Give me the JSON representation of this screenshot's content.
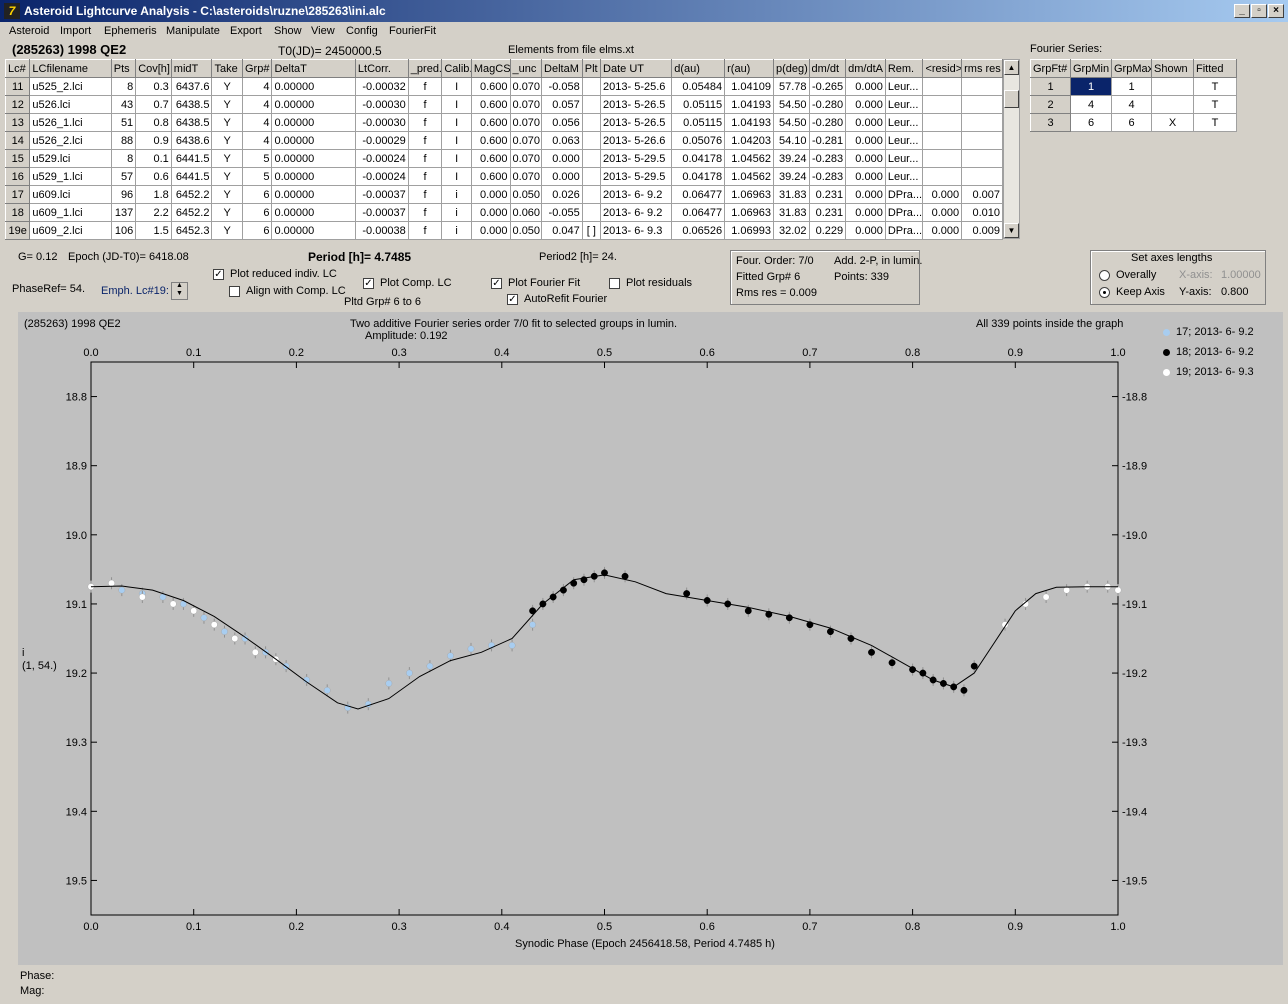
{
  "window": {
    "title": "Asteroid Lightcurve Analysis - C:\\asteroids\\ruzne\\285263\\ini.alc"
  },
  "menu": [
    "Asteroid",
    "Import",
    "Ephemeris",
    "Manipulate",
    "Export",
    "Show",
    "View",
    "Config",
    "FourierFit"
  ],
  "header": {
    "asteroid": "(285263) 1998 QE2",
    "t0": "T0(JD)= 2450000.5",
    "elements": "Elements from file elms.xt"
  },
  "table": {
    "columns": [
      "Lc#",
      "LCfilename",
      "Pts",
      "Cov[h]",
      "midT",
      "Take",
      "Grp#",
      "DeltaT",
      "LtCorr.",
      "_pred.",
      "Calib.",
      "MagCS",
      "_unc",
      "DeltaM",
      "Plt",
      "Date UT",
      "d(au)",
      "r(au)",
      "p(deg)",
      "dm/dt",
      "dm/dtA",
      "Rem.",
      "<resid>",
      "rms res"
    ],
    "rows": [
      [
        "11",
        "u525_2.lci",
        "8",
        "0.3",
        "6437.6",
        "Y",
        "4",
        "0.00000",
        "-0.00032",
        "f",
        "I",
        "0.600",
        "0.070",
        "-0.058",
        "",
        "2013- 5-25.6",
        "0.05484",
        "1.04109",
        "57.78",
        "-0.265",
        "0.000",
        "Leur...",
        "",
        ""
      ],
      [
        "12",
        "u526.lci",
        "43",
        "0.7",
        "6438.5",
        "Y",
        "4",
        "0.00000",
        "-0.00030",
        "f",
        "I",
        "0.600",
        "0.070",
        "0.057",
        "",
        "2013- 5-26.5",
        "0.05115",
        "1.04193",
        "54.50",
        "-0.280",
        "0.000",
        "Leur...",
        "",
        ""
      ],
      [
        "13",
        "u526_1.lci",
        "51",
        "0.8",
        "6438.5",
        "Y",
        "4",
        "0.00000",
        "-0.00030",
        "f",
        "I",
        "0.600",
        "0.070",
        "0.056",
        "",
        "2013- 5-26.5",
        "0.05115",
        "1.04193",
        "54.50",
        "-0.280",
        "0.000",
        "Leur...",
        "",
        ""
      ],
      [
        "14",
        "u526_2.lci",
        "88",
        "0.9",
        "6438.6",
        "Y",
        "4",
        "0.00000",
        "-0.00029",
        "f",
        "I",
        "0.600",
        "0.070",
        "0.063",
        "",
        "2013- 5-26.6",
        "0.05076",
        "1.04203",
        "54.10",
        "-0.281",
        "0.000",
        "Leur...",
        "",
        ""
      ],
      [
        "15",
        "u529.lci",
        "8",
        "0.1",
        "6441.5",
        "Y",
        "5",
        "0.00000",
        "-0.00024",
        "f",
        "I",
        "0.600",
        "0.070",
        "0.000",
        "",
        "2013- 5-29.5",
        "0.04178",
        "1.04562",
        "39.24",
        "-0.283",
        "0.000",
        "Leur...",
        "",
        ""
      ],
      [
        "16",
        "u529_1.lci",
        "57",
        "0.6",
        "6441.5",
        "Y",
        "5",
        "0.00000",
        "-0.00024",
        "f",
        "I",
        "0.600",
        "0.070",
        "0.000",
        "",
        "2013- 5-29.5",
        "0.04178",
        "1.04562",
        "39.24",
        "-0.283",
        "0.000",
        "Leur...",
        "",
        ""
      ],
      [
        "17",
        "u609.lci",
        "96",
        "1.8",
        "6452.2",
        "Y",
        "6",
        "0.00000",
        "-0.00037",
        "f",
        "i",
        "0.000",
        "0.050",
        "0.026",
        "",
        "2013- 6- 9.2",
        "0.06477",
        "1.06963",
        "31.83",
        "0.231",
        "0.000",
        "DPra...",
        "0.000",
        "0.007"
      ],
      [
        "18",
        "u609_1.lci",
        "137",
        "2.2",
        "6452.2",
        "Y",
        "6",
        "0.00000",
        "-0.00037",
        "f",
        "i",
        "0.000",
        "0.060",
        "-0.055",
        "",
        "2013- 6- 9.2",
        "0.06477",
        "1.06963",
        "31.83",
        "0.231",
        "0.000",
        "DPra...",
        "0.000",
        "0.010"
      ],
      [
        "19e",
        "u609_2.lci",
        "106",
        "1.5",
        "6452.3",
        "Y",
        "6",
        "0.00000",
        "-0.00038",
        "f",
        "i",
        "0.000",
        "0.050",
        "0.047",
        "[ ]",
        "2013- 6- 9.3",
        "0.06526",
        "1.06993",
        "32.02",
        "0.229",
        "0.000",
        "DPra...",
        "0.000",
        "0.009"
      ]
    ]
  },
  "fourier_table": {
    "title": "Fourier Series:",
    "columns": [
      "GrpFt#",
      "GrpMin",
      "GrpMax",
      "Shown",
      "Fitted"
    ],
    "rows": [
      [
        "1",
        "1",
        "1",
        "",
        "T"
      ],
      [
        "2",
        "4",
        "4",
        "",
        "T"
      ],
      [
        "3",
        "6",
        "6",
        "X",
        "T"
      ]
    ]
  },
  "controls": {
    "g": "G= 0.12",
    "epoch": "Epoch (JD-T0)= 6418.08",
    "period": "Period [h]= 4.7485",
    "period2": "Period2 [h]= 24.",
    "phaseref": "PhaseRef= 54.",
    "emph": "Emph. Lc#19:",
    "plot_reduced": "Plot reduced indiv. LC",
    "align": "Align with Comp. LC",
    "plot_comp": "Plot Comp. LC",
    "pltd_grp": "Pltd Grp#  6  to   6",
    "plot_fourier": "Plot Fourier Fit",
    "autorefit": "AutoRefit Fourier",
    "plot_resid": "Plot residuals",
    "four_order": "Four. Order:  7/0",
    "add": "Add. 2-P, in lumin.",
    "fitted_grp": "Fitted Grp# 6",
    "points": "Points: 339",
    "rms": "Rms res      = 0.009",
    "axes_title": "Set axes lengths",
    "overally": "Overally",
    "keep_axis": "Keep Axis",
    "xaxis_label": "X-axis:",
    "xaxis_val": "1.00000",
    "yaxis_label": "Y-axis:",
    "yaxis_val": "0.800"
  },
  "plot": {
    "name": "(285263) 1998 QE2",
    "subtitle1": "Two additive Fourier series order 7/0 fit to selected groups in lumin.",
    "subtitle2": "Amplitude: 0.192",
    "inside": "All 339 points inside the graph",
    "ylabel1": "i",
    "ylabel2": "(1, 54.)",
    "xlabel": "Synodic Phase (Epoch 2456418.58, Period 4.7485 h)",
    "legend": [
      {
        "label": "17; 2013- 6- 9.2",
        "color": "#a8cdf0"
      },
      {
        "label": "18; 2013- 6- 9.2",
        "color": "#000000"
      },
      {
        "label": "19; 2013- 6- 9.3",
        "color": "#ffffff"
      }
    ]
  },
  "chart_data": {
    "type": "scatter",
    "xlabel": "Synodic Phase (Epoch 2456418.58, Period 4.7485 h)",
    "ylabel": "i",
    "xlim": [
      0.0,
      1.0
    ],
    "ylim": [
      19.55,
      18.75
    ],
    "x_ticks": [
      "0.0",
      "0.1",
      "0.2",
      "0.3",
      "0.4",
      "0.5",
      "0.6",
      "0.7",
      "0.8",
      "0.9",
      "1.0"
    ],
    "y_ticks": [
      "18.8",
      "18.9",
      "19.0",
      "19.1",
      "19.2",
      "19.3",
      "19.4",
      "19.5"
    ],
    "fit_curve": {
      "x": [
        0.0,
        0.03,
        0.06,
        0.09,
        0.12,
        0.15,
        0.18,
        0.21,
        0.24,
        0.26,
        0.29,
        0.32,
        0.35,
        0.38,
        0.41,
        0.44,
        0.47,
        0.5,
        0.53,
        0.56,
        0.6,
        0.64,
        0.68,
        0.72,
        0.76,
        0.79,
        0.82,
        0.84,
        0.86,
        0.88,
        0.9,
        0.92,
        0.94,
        0.97,
        1.0
      ],
      "y": [
        19.075,
        19.074,
        19.08,
        19.095,
        19.118,
        19.148,
        19.18,
        19.213,
        19.243,
        19.252,
        19.237,
        19.205,
        19.182,
        19.17,
        19.15,
        19.1,
        19.065,
        19.058,
        19.068,
        19.085,
        19.095,
        19.105,
        19.118,
        19.135,
        19.16,
        19.185,
        19.21,
        19.22,
        19.2,
        19.155,
        19.11,
        19.085,
        19.076,
        19.075,
        19.075
      ]
    },
    "series": [
      {
        "name": "17; 2013- 6- 9.2",
        "color": "#a8cdf0",
        "x": [
          0.03,
          0.05,
          0.07,
          0.09,
          0.11,
          0.13,
          0.15,
          0.17,
          0.19,
          0.21,
          0.23,
          0.25,
          0.27,
          0.29,
          0.31,
          0.33,
          0.35,
          0.37,
          0.39,
          0.41,
          0.43
        ],
        "y": [
          19.08,
          19.085,
          19.09,
          19.1,
          19.12,
          19.14,
          19.15,
          19.17,
          19.19,
          19.21,
          19.225,
          19.25,
          19.245,
          19.215,
          19.2,
          19.19,
          19.175,
          19.165,
          19.16,
          19.16,
          19.13
        ]
      },
      {
        "name": "18; 2013- 6- 9.2",
        "color": "#000000",
        "x": [
          0.43,
          0.44,
          0.45,
          0.46,
          0.47,
          0.48,
          0.49,
          0.5,
          0.52,
          0.58,
          0.6,
          0.62,
          0.64,
          0.66,
          0.68,
          0.7,
          0.72,
          0.74,
          0.76,
          0.78,
          0.8,
          0.81,
          0.82,
          0.83,
          0.84,
          0.85,
          0.86
        ],
        "y": [
          19.11,
          19.1,
          19.09,
          19.08,
          19.07,
          19.065,
          19.06,
          19.055,
          19.06,
          19.085,
          19.095,
          19.1,
          19.11,
          19.115,
          19.12,
          19.13,
          19.14,
          19.15,
          19.17,
          19.185,
          19.195,
          19.2,
          19.21,
          19.215,
          19.22,
          19.225,
          19.19
        ]
      },
      {
        "name": "19; 2013- 6- 9.3",
        "color": "#ffffff",
        "x": [
          0.0,
          0.02,
          0.05,
          0.08,
          0.1,
          0.12,
          0.14,
          0.16,
          0.18,
          0.89,
          0.91,
          0.93,
          0.95,
          0.97,
          0.99,
          1.0
        ],
        "y": [
          19.075,
          19.07,
          19.09,
          19.1,
          19.11,
          19.13,
          19.15,
          19.17,
          19.18,
          19.13,
          19.1,
          19.09,
          19.08,
          19.075,
          19.075,
          19.08
        ]
      }
    ]
  },
  "status": {
    "phase": "Phase:",
    "mag": "Mag:"
  }
}
